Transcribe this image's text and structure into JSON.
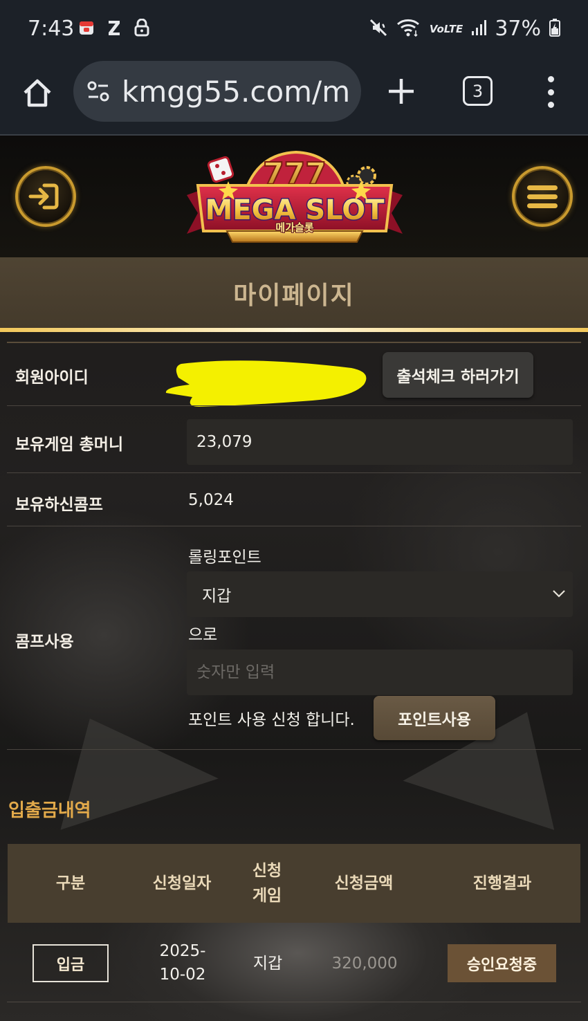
{
  "status_bar": {
    "time": "7:43",
    "left_icons": [
      "calendar-icon",
      "z-app-icon",
      "lock-icon"
    ],
    "network": "VoLTE",
    "battery": "37%",
    "right_icons": [
      "mute-icon",
      "wifi-icon",
      "signal-icon",
      "battery-icon"
    ]
  },
  "browser": {
    "url": "kmgg55.com/m",
    "tab_count": "3"
  },
  "site": {
    "logo_main": "MEGA SLOT",
    "logo_sub": "메가슬롯",
    "page_title": "마이페이지"
  },
  "member": {
    "id_label": "회원아이디",
    "attendance_button": "출석체크 하러가기",
    "money_label": "보유게임 총머니",
    "money_value": "23,079",
    "comp_label": "보유하신콤프",
    "comp_value": "5,024"
  },
  "comp_use": {
    "label": "콤프사용",
    "rolling_label": "롤링포인트",
    "target_select": "지갑",
    "to_text": "으로",
    "amount_placeholder": "숫자만 입력",
    "apply_text": "포인트 사용 신청 합니다.",
    "apply_button": "포인트사용"
  },
  "history": {
    "title": "입출금내역",
    "columns": [
      "구분",
      "신청일자",
      "신청\n게임",
      "신청금액",
      "진행결과"
    ],
    "rows": [
      {
        "type": "입금",
        "date": "2025-\n10-02",
        "game": "지갑",
        "amount": "320,000",
        "status": "승인요청중"
      }
    ]
  },
  "colors": {
    "gold": "#c99a2e",
    "header_band": "#4f4433",
    "section_orange": "#e2a94a",
    "status_badge": "#6b5236",
    "redaction": "#f4f000"
  }
}
